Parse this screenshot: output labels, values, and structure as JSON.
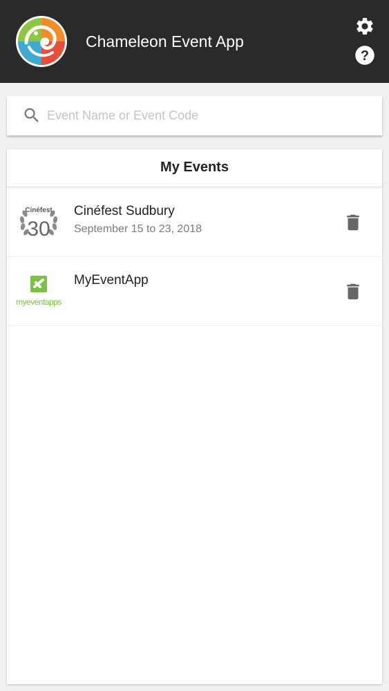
{
  "header": {
    "title": "Chameleon Event App",
    "logo_icon": "chameleon-logo",
    "settings_icon": "gear-icon",
    "help_icon": "help-icon",
    "background_color": "#2a2a2a"
  },
  "search": {
    "placeholder": "Event Name or Event Code",
    "value": "",
    "icon": "search-icon"
  },
  "my_events": {
    "title": "My Events",
    "items": [
      {
        "name": "Cinéfest Sudbury",
        "date": "September 15 to 23, 2018",
        "logo_text_top": "Cinéfest",
        "logo_text_number": "30",
        "delete_icon": "trash-icon"
      },
      {
        "name": "MyEventApp",
        "date": "",
        "logo_text": "myeventapps",
        "delete_icon": "trash-icon"
      }
    ]
  },
  "colors": {
    "accent_green": "#7cc242",
    "icon_gray": "#666666",
    "page_background": "#f0f0f0"
  }
}
